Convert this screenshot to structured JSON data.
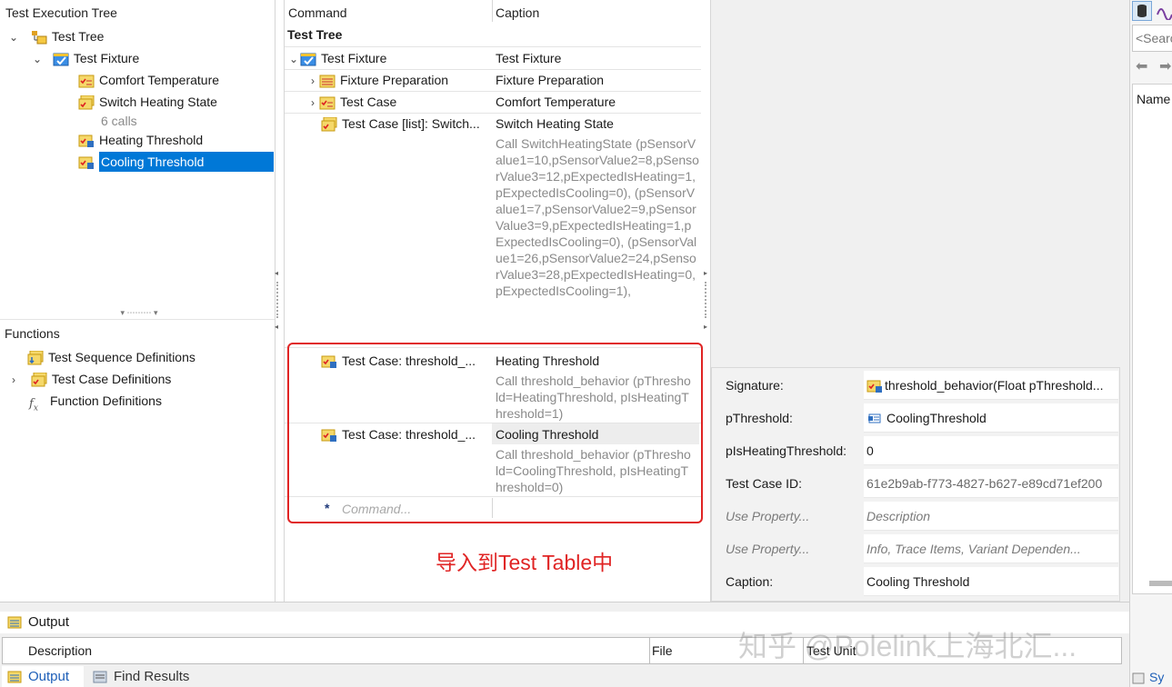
{
  "exec_tree": {
    "title": "Test Execution Tree",
    "items": [
      {
        "label": "Test Tree"
      },
      {
        "label": "Test Fixture"
      },
      {
        "label": "Comfort Temperature"
      },
      {
        "label": "Switch Heating State"
      },
      {
        "label": "6 calls"
      },
      {
        "label": "Heating Threshold"
      },
      {
        "label": "Cooling Threshold"
      }
    ]
  },
  "functions": {
    "title": "Functions",
    "items": [
      {
        "label": "Test Sequence Definitions"
      },
      {
        "label": "Test Case Definitions"
      },
      {
        "label": "Function Definitions"
      }
    ]
  },
  "table": {
    "col_command": "Command",
    "col_caption": "Caption",
    "group": "Test Tree",
    "rows": [
      {
        "command": "Test Fixture",
        "caption": "Test Fixture"
      },
      {
        "command": "Fixture Preparation",
        "caption": "Fixture Preparation"
      },
      {
        "command": "Test Case",
        "caption": "Comfort Temperature"
      },
      {
        "command": "Test Case [list]: Switch...",
        "caption": "Switch Heating State",
        "detail": "Call SwitchHeatingState (pSensorValue1=10,pSensorValue2=8,pSensorValue3=12,pExpectedIsHeating=1,pExpectedIsCooling=0), (pSensorValue1=7,pSensorValue2=9,pSensorValue3=9,pExpectedIsHeating=1,pExpectedIsCooling=0), (pSensorValue1=26,pSensorValue2=24,pSensorValue3=28,pExpectedIsHeating=0,pExpectedIsCooling=1),"
      },
      {
        "command": "Test Case: threshold_...",
        "caption": "Heating Threshold",
        "detail": "Call threshold_behavior (pThreshold=HeatingThreshold, pIsHeatingThreshold=1)"
      },
      {
        "command": "Test Case: threshold_...",
        "caption": "Cooling Threshold",
        "detail": "Call threshold_behavior (pThreshold=CoolingThreshold, pIsHeatingThreshold=0)"
      }
    ],
    "new_command_placeholder": "Command...",
    "annotation": "导入到Test Table中"
  },
  "properties": [
    {
      "label": "Signature:",
      "value": "threshold_behavior(Float pThreshold..."
    },
    {
      "label": "pThreshold:",
      "value": "CoolingThreshold"
    },
    {
      "label": "pIsHeatingThreshold:",
      "value": "0"
    },
    {
      "label": "Test Case ID:",
      "value": "61e2b9ab-f773-4827-b627-e89cd71ef200"
    },
    {
      "label": "Use Property...",
      "value": "Description"
    },
    {
      "label": "Use Property...",
      "value": "Info, Trace Items, Variant Dependen..."
    },
    {
      "label": "Caption:",
      "value": "Cooling Threshold"
    }
  ],
  "right_panel": {
    "search_placeholder": "<Search",
    "col_name": "Name",
    "tab": "Sy"
  },
  "output": {
    "title": "Output",
    "col_description": "Description",
    "col_file": "File",
    "col_test_unit": "Test Unit",
    "tabs": [
      {
        "label": "Output"
      },
      {
        "label": "Find Results"
      }
    ]
  },
  "watermark": "知乎 @Polelink上海北汇...",
  "colors": {
    "selection": "#0078d7",
    "annotation_red": "#e02424",
    "detail_gray": "#8a8a8a"
  }
}
